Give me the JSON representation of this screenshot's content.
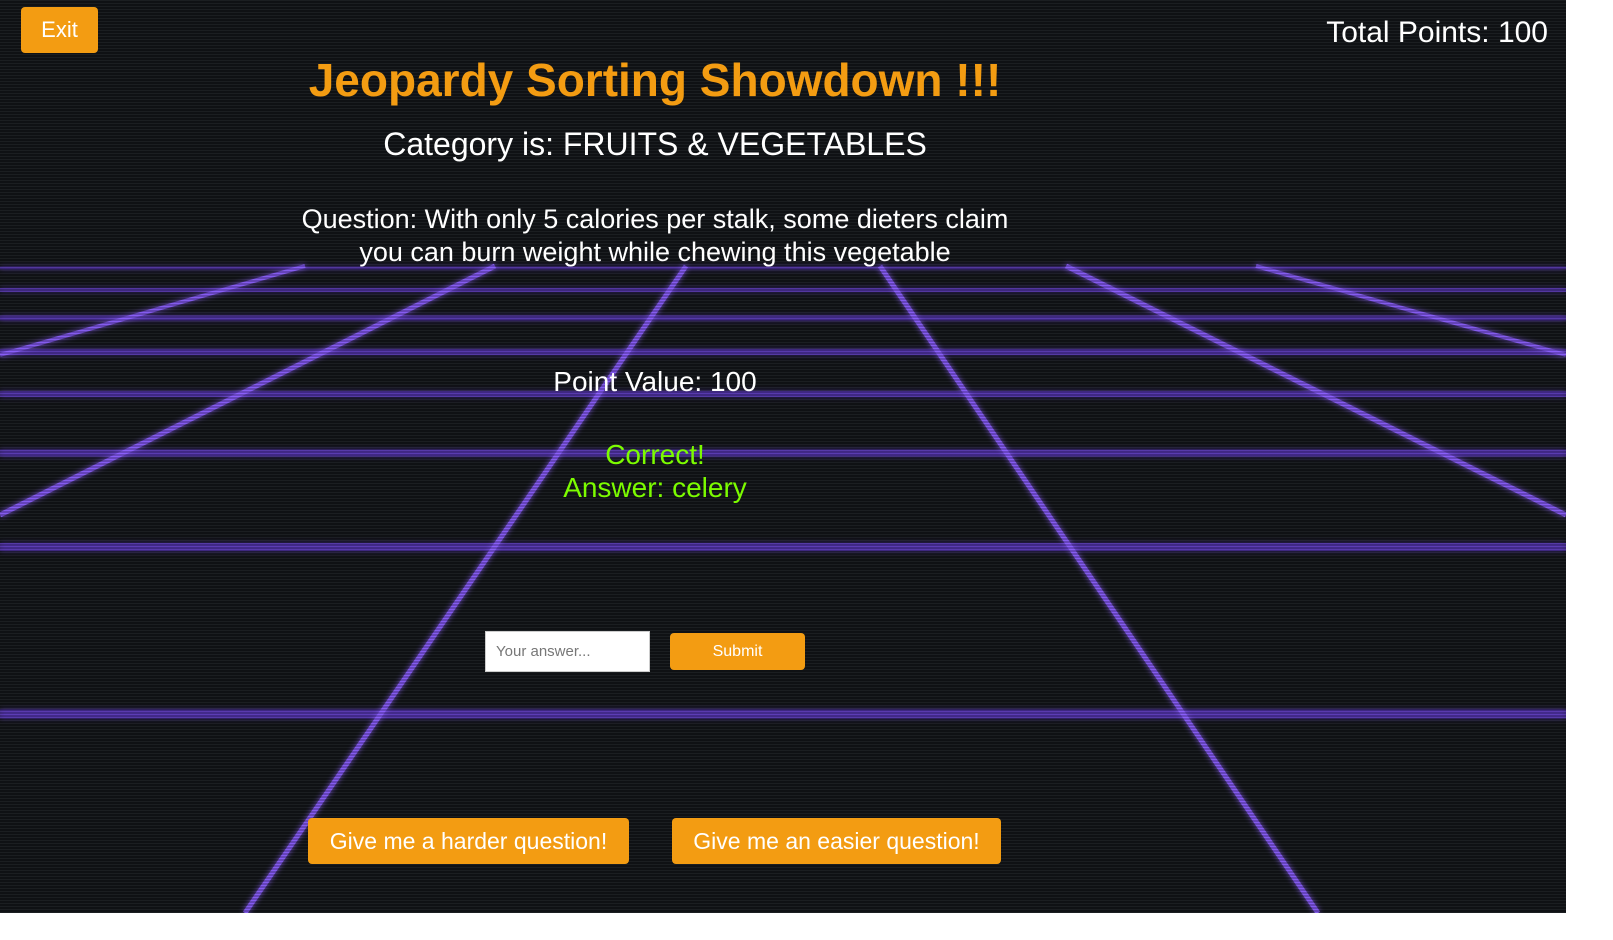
{
  "header": {
    "exit_label": "Exit",
    "total_points": "Total Points: 100"
  },
  "game": {
    "title": "Jeopardy Sorting Showdown !!!",
    "category": "Category is: FRUITS & VEGETABLES",
    "question_line1": "Question: With only 5 calories per stalk, some dieters claim",
    "question_line2": "you can burn weight while chewing this vegetable",
    "point_value": "Point Value: 100",
    "result_status": "Correct!",
    "result_answer": "Answer: celery"
  },
  "form": {
    "answer_placeholder": "Your answer...",
    "answer_value": "",
    "submit_label": "Submit"
  },
  "actions": {
    "harder_label": "Give me a harder question!",
    "easier_label": "Give me an easier question!"
  },
  "colors": {
    "accent": "#f39c12",
    "correct": "#7cfc00",
    "grid": "#7b4dff",
    "background": "#131619"
  }
}
